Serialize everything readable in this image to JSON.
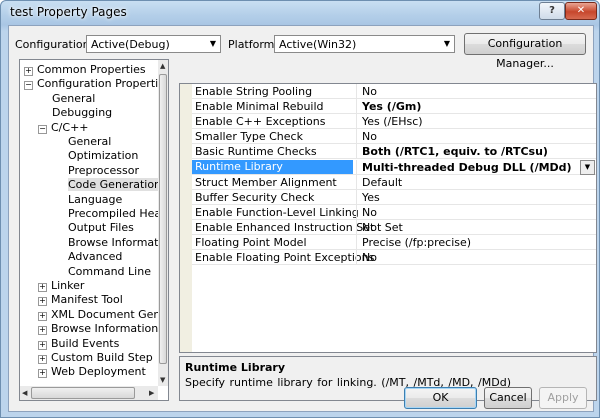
{
  "window": {
    "title": "test Property Pages",
    "help_glyph": "?",
    "close_glyph": "✕"
  },
  "toolbar": {
    "configuration_label": "Configuration:",
    "configuration_value": "Active(Debug)",
    "platform_label": "Platform:",
    "platform_value": "Active(Win32)",
    "config_manager_label": "Configuration Manager..."
  },
  "tree": {
    "items": [
      {
        "label": "Common Properties",
        "expander": "+"
      },
      {
        "label": "Configuration Properties",
        "expander": "−"
      },
      {
        "label": "General",
        "expander": ""
      },
      {
        "label": "Debugging",
        "expander": ""
      },
      {
        "label": "C/C++",
        "expander": "−"
      },
      {
        "label": "General",
        "expander": ""
      },
      {
        "label": "Optimization",
        "expander": ""
      },
      {
        "label": "Preprocessor",
        "expander": ""
      },
      {
        "label": "Code Generation",
        "expander": ""
      },
      {
        "label": "Language",
        "expander": ""
      },
      {
        "label": "Precompiled Heade",
        "expander": ""
      },
      {
        "label": "Output Files",
        "expander": ""
      },
      {
        "label": "Browse Information",
        "expander": ""
      },
      {
        "label": "Advanced",
        "expander": ""
      },
      {
        "label": "Command Line",
        "expander": ""
      },
      {
        "label": "Linker",
        "expander": "+"
      },
      {
        "label": "Manifest Tool",
        "expander": "+"
      },
      {
        "label": "XML Document Genera",
        "expander": "+"
      },
      {
        "label": "Browse Information",
        "expander": "+"
      },
      {
        "label": "Build Events",
        "expander": "+"
      },
      {
        "label": "Custom Build Step",
        "expander": "+"
      },
      {
        "label": "Web Deployment",
        "expander": "+"
      }
    ],
    "selected_index": 8
  },
  "properties": [
    {
      "name": "Enable String Pooling",
      "value": "No"
    },
    {
      "name": "Enable Minimal Rebuild",
      "value": "Yes (/Gm)"
    },
    {
      "name": "Enable C++ Exceptions",
      "value": "Yes (/EHsc)"
    },
    {
      "name": "Smaller Type Check",
      "value": "No"
    },
    {
      "name": "Basic Runtime Checks",
      "value": "Both (/RTC1, equiv. to /RTCsu)"
    },
    {
      "name": "Runtime Library",
      "value": "Multi-threaded Debug DLL (/MDd)"
    },
    {
      "name": "Struct Member Alignment",
      "value": "Default"
    },
    {
      "name": "Buffer Security Check",
      "value": "Yes"
    },
    {
      "name": "Enable Function-Level Linking",
      "value": "No"
    },
    {
      "name": "Enable Enhanced Instruction Set",
      "value": "Not Set"
    },
    {
      "name": "Floating Point Model",
      "value": "Precise (/fp:precise)"
    },
    {
      "name": "Enable Floating Point Exceptions",
      "value": "No"
    }
  ],
  "description": {
    "title": "Runtime Library",
    "text": "Specify runtime library for linking.    (/MT, /MTd, /MD, /MDd)"
  },
  "buttons": {
    "ok": "OK",
    "cancel": "Cancel",
    "apply": "Apply"
  },
  "colors": {
    "selection": "#3399ff",
    "title_gradient": "#b4cfe9",
    "dialog_bg": "#f0f0f0"
  },
  "icons": {
    "expand": "plus-box-icon",
    "collapse": "minus-box-icon",
    "dropdown": "chevron-down-icon"
  }
}
